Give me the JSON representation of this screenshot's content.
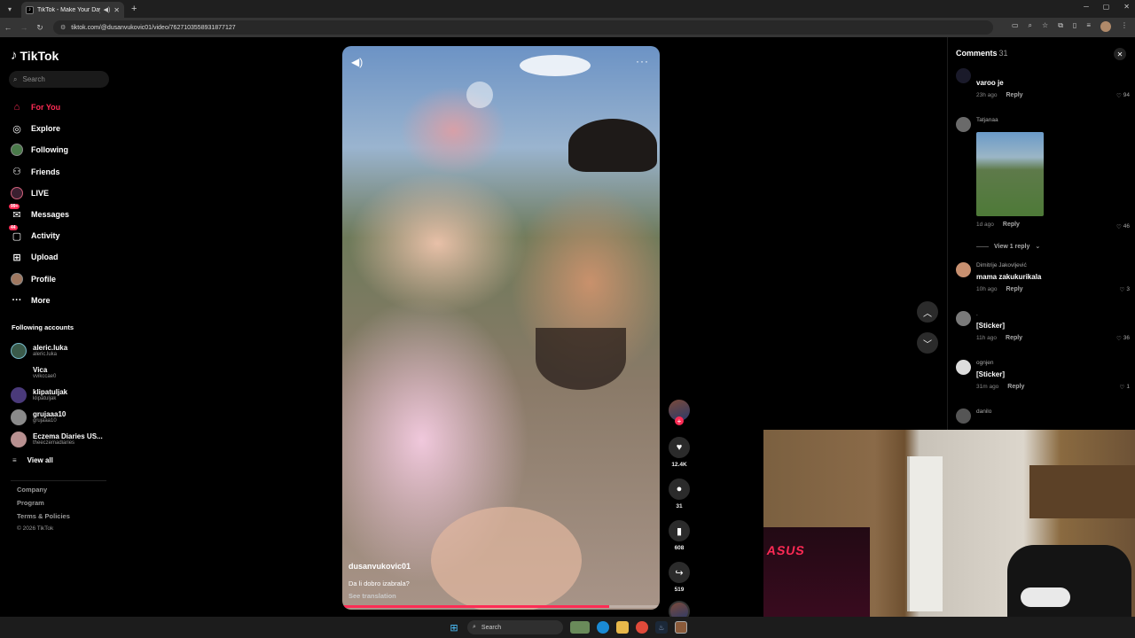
{
  "browser": {
    "tab_title": "TikTok - Make Your Day",
    "url": "tiktok.com/@dusanvukovic01/video/7627103558931877127"
  },
  "sidebar": {
    "logo": "TikTok",
    "search_placeholder": "Search",
    "menu": [
      {
        "label": "For You",
        "icon": "home-icon"
      },
      {
        "label": "Explore",
        "icon": "compass-icon"
      },
      {
        "label": "Following",
        "icon": "following-avatar-icon"
      },
      {
        "label": "Friends",
        "icon": "friends-icon"
      },
      {
        "label": "LIVE",
        "icon": "live-icon"
      },
      {
        "label": "Messages",
        "icon": "messages-icon",
        "badge": "99+"
      },
      {
        "label": "Activity",
        "icon": "activity-icon",
        "badge": "44"
      },
      {
        "label": "Upload",
        "icon": "upload-icon"
      },
      {
        "label": "Profile",
        "icon": "profile-icon"
      },
      {
        "label": "More",
        "icon": "more-icon"
      }
    ],
    "following_title": "Following accounts",
    "accounts": [
      {
        "name": "aleric.luka",
        "handle": "aleric.luka"
      },
      {
        "name": "Vica",
        "handle": "vvikccae0"
      },
      {
        "name": "klipatuljak",
        "handle": "klipatuljak"
      },
      {
        "name": "grujaaa10",
        "handle": "grujaaa10"
      },
      {
        "name": "Eczema Diaries US...",
        "handle": "theeczemadiaries"
      }
    ],
    "view_all": "View all",
    "footer": [
      "Company",
      "Program",
      "Terms & Policies"
    ],
    "copyright": "© 2026 TikTok"
  },
  "video": {
    "author": "dusanvukovic01",
    "caption": "Da li dobro izabrala?",
    "see_translation": "See translation",
    "progress": 0.84
  },
  "actions": {
    "likes": "12.4K",
    "comments": "31",
    "saves": "608",
    "shares": "519"
  },
  "comments_panel": {
    "title": "Comments",
    "count": "31",
    "reply_label": "Reply",
    "view_replies": "View 1 reply",
    "items": [
      {
        "user": "",
        "text": "varoo je",
        "time": "23h ago",
        "likes": "94"
      },
      {
        "user": "Tatjanaa",
        "text": "",
        "time": "1d ago",
        "likes": "46"
      },
      {
        "user": "Dimitrije Jakovljević",
        "text": "mama zakukurikala",
        "time": "10h ago",
        "likes": "3"
      },
      {
        "user": ".",
        "text": "[Sticker]",
        "time": "11h ago",
        "likes": "36"
      },
      {
        "user": "ognjen",
        "text": "[Sticker]",
        "time": "31m ago",
        "likes": "1"
      },
      {
        "user": "danilo",
        "text": "",
        "time": "",
        "likes": ""
      }
    ]
  },
  "taskbar": {
    "search_label": "Search"
  }
}
